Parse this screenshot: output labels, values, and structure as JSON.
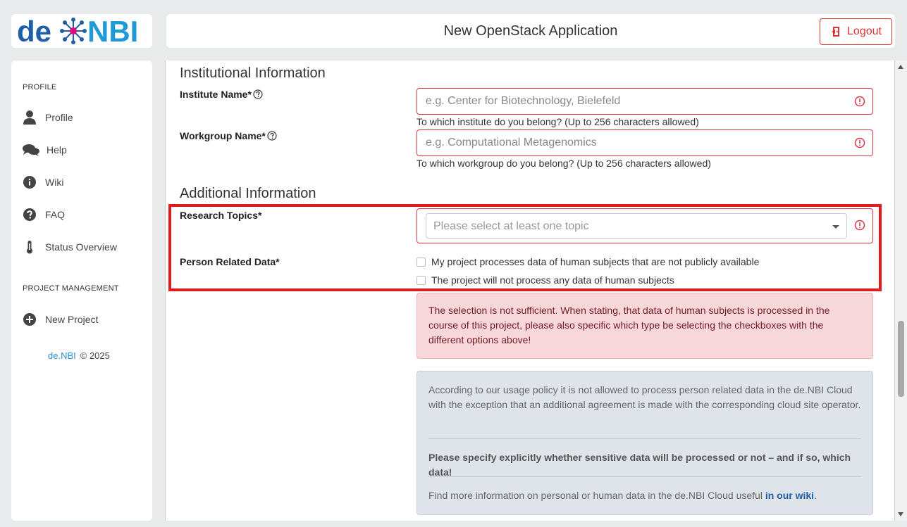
{
  "logo": {
    "text_left": "de",
    "text_right": "NBI"
  },
  "header": {
    "title": "New OpenStack Application",
    "logout_label": "Logout"
  },
  "sidebar": {
    "profile_heading": "PROFILE",
    "items": [
      {
        "label": "Profile",
        "icon": "user-icon"
      },
      {
        "label": "Help",
        "icon": "chat-icon"
      },
      {
        "label": "Wiki",
        "icon": "info-icon"
      },
      {
        "label": "FAQ",
        "icon": "question-icon"
      },
      {
        "label": "Status Overview",
        "icon": "thermometer-icon"
      }
    ],
    "project_heading": "PROJECT MANAGEMENT",
    "new_project_label": "New Project",
    "footer_brand": "de.NBI",
    "footer_copy": "© 2025"
  },
  "form": {
    "institutional_title": "Institutional Information",
    "institute": {
      "label": "Institute Name*",
      "placeholder": "e.g. Center for Biotechnology, Bielefeld",
      "hint": "To which institute do you belong? (Up to 256 characters allowed)"
    },
    "workgroup": {
      "label": "Workgroup Name*",
      "placeholder": "e.g. Computational Metagenomics",
      "hint": "To which workgroup do you belong? (Up to 256 characters allowed)"
    },
    "additional_title": "Additional Information",
    "research_topics": {
      "label": "Research Topics*",
      "placeholder": "Please select at least one topic"
    },
    "person_data": {
      "label": "Person Related Data*",
      "option_1": "My project processes data of human subjects that are not publicly available",
      "option_2": "The project will not process any data of human subjects"
    },
    "error_message": "The selection is not sufficient. When stating, that data of human subjects is processed in the course of this project, please also specific which type be selecting the checkboxes with the different options above!",
    "info": {
      "para_1": "According to our usage policy it is not allowed to process person related data in the de.NBI Cloud with the exception that an additional agreement is made with the corresponding cloud site operator.",
      "para_2": "Please specify explicitly whether sensitive data will be processed or not – and if so, which data!",
      "para_3_text": "Find more information on personal or human data in the de.NBI Cloud useful ",
      "para_3_link": "in our wiki",
      "para_3_end": "."
    }
  },
  "colors": {
    "brand_blue": "#1f5fa8",
    "accent_red": "#dc3545",
    "highlight_red": "#e01c1c",
    "logo_magenta": "#e6007e"
  }
}
